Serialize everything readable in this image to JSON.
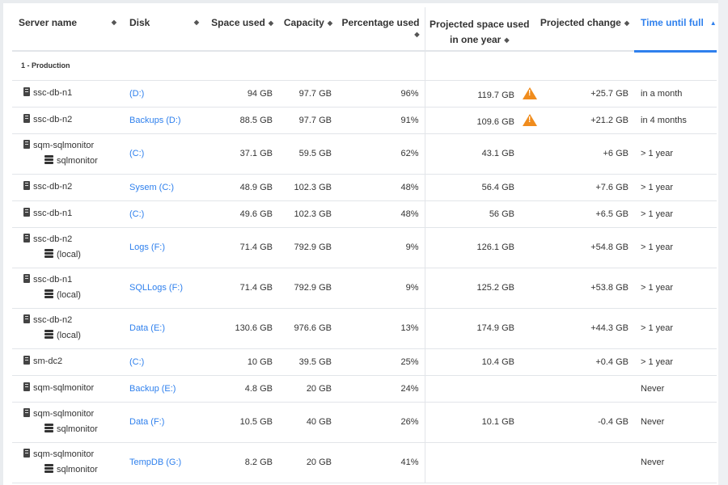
{
  "columns": {
    "server_name": "Server name",
    "disk": "Disk",
    "space_used": "Space used",
    "capacity": "Capacity",
    "percentage_used": "Percentage used",
    "projected_space_line1": "Projected space used",
    "projected_space_line2": "in one year",
    "projected_change": "Projected change",
    "time_until_full": "Time until full"
  },
  "group_label": "1 - Production",
  "rows": [
    {
      "server": "ssc-db-n1",
      "instance": "",
      "disk": "(D:)",
      "space": "94 GB",
      "capacity": "97.7 GB",
      "pct": "96%",
      "projected": "119.7 GB",
      "warning": true,
      "change": "+25.7 GB",
      "time": "in a month"
    },
    {
      "server": "ssc-db-n2",
      "instance": "",
      "disk": "Backups (D:)",
      "space": "88.5 GB",
      "capacity": "97.7 GB",
      "pct": "91%",
      "projected": "109.6 GB",
      "warning": true,
      "change": "+21.2 GB",
      "time": "in 4 months"
    },
    {
      "server": "sqm-sqlmonitor",
      "instance": "sqlmonitor",
      "disk": "(C:)",
      "space": "37.1 GB",
      "capacity": "59.5 GB",
      "pct": "62%",
      "projected": "43.1 GB",
      "warning": false,
      "change": "+6 GB",
      "time": "> 1 year"
    },
    {
      "server": "ssc-db-n2",
      "instance": "",
      "disk": "Sysem (C:)",
      "space": "48.9 GB",
      "capacity": "102.3 GB",
      "pct": "48%",
      "projected": "56.4 GB",
      "warning": false,
      "change": "+7.6 GB",
      "time": "> 1 year"
    },
    {
      "server": "ssc-db-n1",
      "instance": "",
      "disk": "(C:)",
      "space": "49.6 GB",
      "capacity": "102.3 GB",
      "pct": "48%",
      "projected": "56 GB",
      "warning": false,
      "change": "+6.5 GB",
      "time": "> 1 year"
    },
    {
      "server": "ssc-db-n2",
      "instance": "(local)",
      "disk": "Logs (F:)",
      "space": "71.4 GB",
      "capacity": "792.9 GB",
      "pct": "9%",
      "projected": "126.1 GB",
      "warning": false,
      "change": "+54.8 GB",
      "time": "> 1 year"
    },
    {
      "server": "ssc-db-n1",
      "instance": "(local)",
      "disk": "SQLLogs (F:)",
      "space": "71.4 GB",
      "capacity": "792.9 GB",
      "pct": "9%",
      "projected": "125.2 GB",
      "warning": false,
      "change": "+53.8 GB",
      "time": "> 1 year"
    },
    {
      "server": "ssc-db-n2",
      "instance": "(local)",
      "disk": "Data (E:)",
      "space": "130.6 GB",
      "capacity": "976.6 GB",
      "pct": "13%",
      "projected": "174.9 GB",
      "warning": false,
      "change": "+44.3 GB",
      "time": "> 1 year"
    },
    {
      "server": "sm-dc2",
      "instance": "",
      "disk": "(C:)",
      "space": "10 GB",
      "capacity": "39.5 GB",
      "pct": "25%",
      "projected": "10.4 GB",
      "warning": false,
      "change": "+0.4 GB",
      "time": "> 1 year"
    },
    {
      "server": "sqm-sqlmonitor",
      "instance": "",
      "disk": "Backup (E:)",
      "space": "4.8 GB",
      "capacity": "20 GB",
      "pct": "24%",
      "projected": "",
      "warning": false,
      "change": "",
      "time": "Never"
    },
    {
      "server": "sqm-sqlmonitor",
      "instance": "sqlmonitor",
      "disk": "Data (F:)",
      "space": "10.5 GB",
      "capacity": "40 GB",
      "pct": "26%",
      "projected": "10.1 GB",
      "warning": false,
      "change": "-0.4 GB",
      "time": "Never"
    },
    {
      "server": "sqm-sqlmonitor",
      "instance": "sqlmonitor",
      "disk": "TempDB (G:)",
      "space": "8.2 GB",
      "capacity": "20 GB",
      "pct": "41%",
      "projected": "",
      "warning": false,
      "change": "",
      "time": "Never"
    }
  ],
  "colors": {
    "accent": "#2f80ed",
    "warning": "#f08c1d"
  }
}
